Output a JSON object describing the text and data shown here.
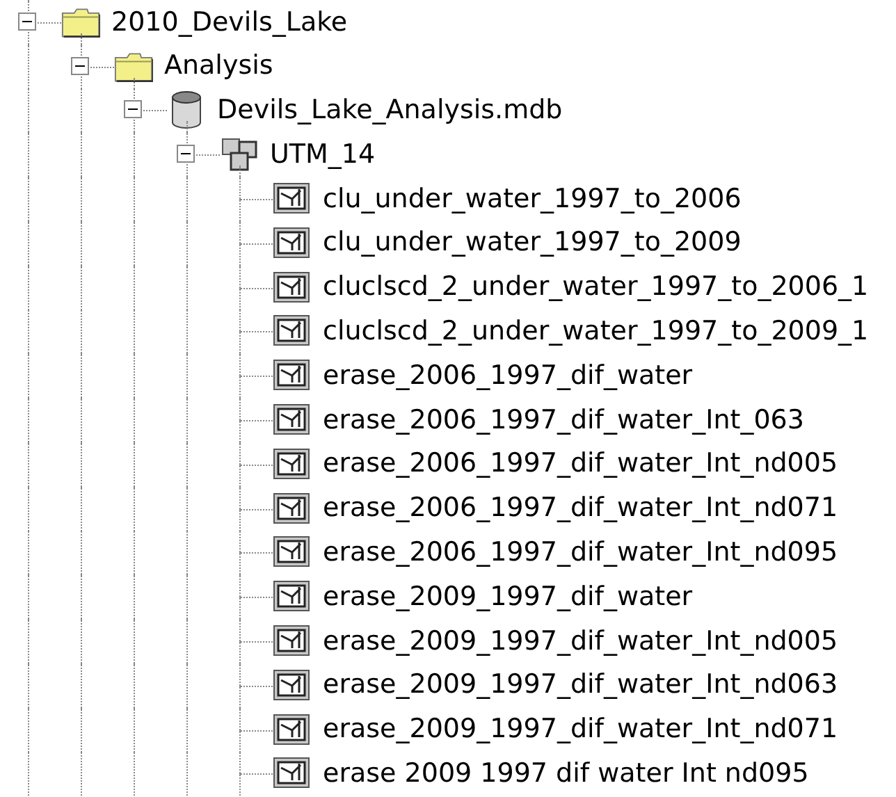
{
  "tree": [
    {
      "label": "2010_Devils_Lake",
      "kind": "folder",
      "expanded": true,
      "children": [
        {
          "label": "Analysis",
          "kind": "folder",
          "expanded": true,
          "children": [
            {
              "label": "Devils_Lake_Analysis.mdb",
              "kind": "database",
              "expanded": true,
              "children": [
                {
                  "label": "UTM_14",
                  "kind": "dataset",
                  "expanded": true,
                  "children": [
                    {
                      "label": "clu_under_water_1997_to_2006",
                      "kind": "feature"
                    },
                    {
                      "label": "clu_under_water_1997_to_2009",
                      "kind": "feature"
                    },
                    {
                      "label": "cluclscd_2_under_water_1997_to_2006_1",
                      "kind": "feature"
                    },
                    {
                      "label": "cluclscd_2_under_water_1997_to_2009_1",
                      "kind": "feature"
                    },
                    {
                      "label": "erase_2006_1997_dif_water",
                      "kind": "feature"
                    },
                    {
                      "label": "erase_2006_1997_dif_water_Int_063",
                      "kind": "feature"
                    },
                    {
                      "label": "erase_2006_1997_dif_water_Int_nd005",
                      "kind": "feature"
                    },
                    {
                      "label": "erase_2006_1997_dif_water_Int_nd071",
                      "kind": "feature"
                    },
                    {
                      "label": "erase_2006_1997_dif_water_Int_nd095",
                      "kind": "feature"
                    },
                    {
                      "label": "erase_2009_1997_dif_water",
                      "kind": "feature"
                    },
                    {
                      "label": "erase_2009_1997_dif_water_Int_nd005",
                      "kind": "feature"
                    },
                    {
                      "label": "erase_2009_1997_dif_water_Int_nd063",
                      "kind": "feature"
                    },
                    {
                      "label": "erase_2009_1997_dif_water_Int_nd071",
                      "kind": "feature"
                    },
                    {
                      "label": "erase 2009 1997 dif water Int nd095",
                      "kind": "feature"
                    }
                  ]
                }
              ]
            }
          ]
        }
      ]
    }
  ]
}
